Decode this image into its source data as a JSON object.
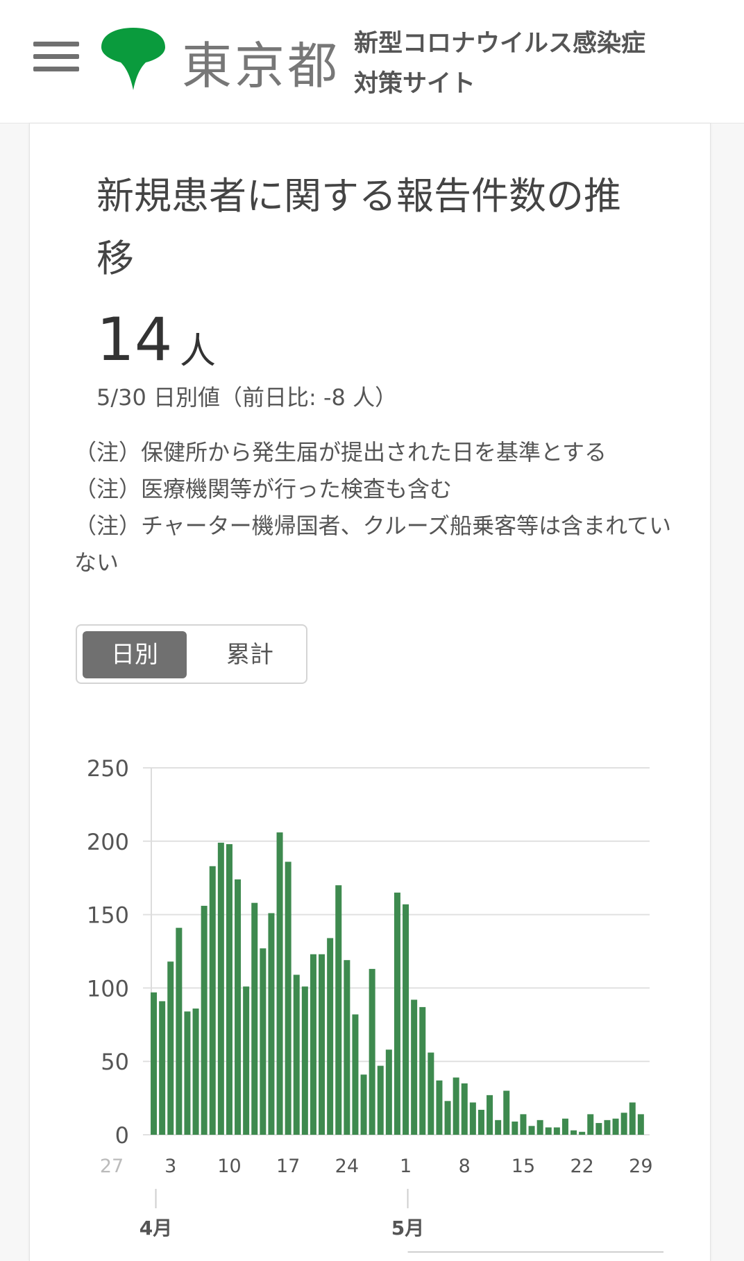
{
  "header": {
    "logo_text": "東京都",
    "site_title_line1": "新型コロナウイルス感染症",
    "site_title_line2": "対策サイト"
  },
  "card": {
    "title": "新規患者に関する報告件数の推移",
    "value": "14",
    "unit": "人",
    "sub_value": "5/30 日別値（前日比: -8 人）",
    "notes": [
      "（注）保健所から発生届が提出された日を基準とする",
      "（注）医療機関等が行った検査も含む",
      "（注）チャーター機帰国者、クルーズ船乗客等は含まれていない"
    ],
    "toggle": {
      "daily": "日別",
      "cumulative": "累計"
    }
  },
  "colors": {
    "bar": "#3e8a4f",
    "accent": "#00a040"
  },
  "chart_data": {
    "type": "bar",
    "ylim": [
      0,
      250
    ],
    "yticks": [
      "0",
      "50",
      "100",
      "150",
      "200",
      "250"
    ],
    "x_tick_labels": [
      {
        "label": "27",
        "index": 0,
        "faded": true
      },
      {
        "label": "3",
        "index": 7
      },
      {
        "label": "10",
        "index": 14
      },
      {
        "label": "17",
        "index": 21
      },
      {
        "label": "24",
        "index": 28
      },
      {
        "label": "1",
        "index": 35
      },
      {
        "label": "8",
        "index": 42
      },
      {
        "label": "15",
        "index": 49
      },
      {
        "label": "22",
        "index": 56
      },
      {
        "label": "29",
        "index": 63
      }
    ],
    "month_labels": [
      {
        "label": "4月",
        "index": 5
      },
      {
        "label": "5月",
        "index": 35
      }
    ],
    "first_bar_index": 5,
    "values": [
      97,
      91,
      118,
      141,
      84,
      86,
      156,
      183,
      199,
      198,
      174,
      101,
      158,
      127,
      151,
      206,
      186,
      109,
      101,
      123,
      123,
      134,
      170,
      119,
      82,
      41,
      113,
      47,
      58,
      165,
      157,
      92,
      87,
      56,
      37,
      23,
      39,
      35,
      22,
      17,
      27,
      10,
      30,
      9,
      14,
      6,
      10,
      5,
      5,
      11,
      3,
      2,
      14,
      8,
      10,
      11,
      15,
      22,
      14
    ]
  }
}
